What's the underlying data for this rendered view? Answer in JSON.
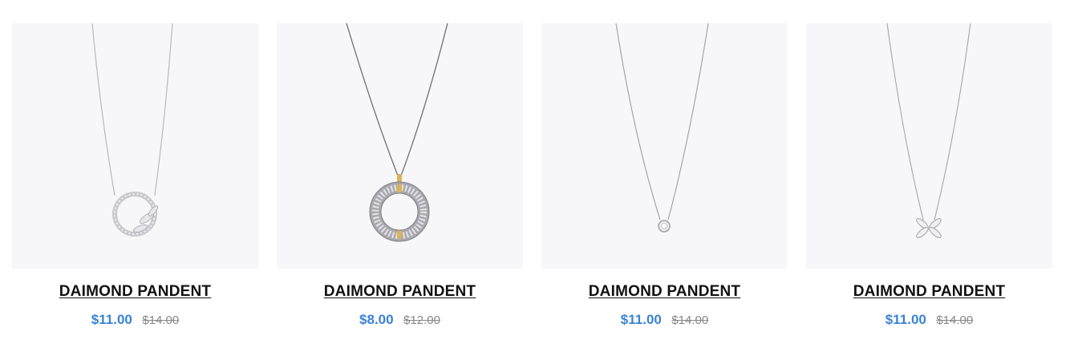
{
  "products": [
    {
      "title": "DAIMOND PANDENT",
      "price": "$11.00",
      "old_price": "$14.00",
      "image": "leaf-circle-pendant"
    },
    {
      "title": "DAIMOND PANDENT",
      "price": "$8.00",
      "old_price": "$12.00",
      "image": "pave-ring-pendant"
    },
    {
      "title": "DAIMOND PANDENT",
      "price": "$11.00",
      "old_price": "$14.00",
      "image": "solitaire-pendant"
    },
    {
      "title": "DAIMOND PANDENT",
      "price": "$11.00",
      "old_price": "$14.00",
      "image": "victoria-pendant"
    }
  ],
  "colors": {
    "price": "#3b82d6",
    "old_price": "#888888",
    "image_bg": "#f7f7f9",
    "title": "#111111"
  }
}
